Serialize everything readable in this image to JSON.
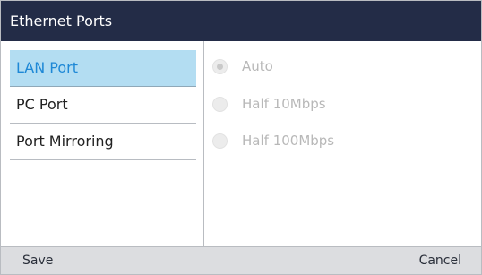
{
  "header": {
    "title": "Ethernet Ports"
  },
  "sidebar": {
    "items": [
      {
        "label": "LAN Port",
        "selected": true
      },
      {
        "label": "PC Port",
        "selected": false
      },
      {
        "label": "Port Mirroring",
        "selected": false
      }
    ]
  },
  "main": {
    "options": [
      {
        "label": "Auto",
        "checked": true,
        "disabled": true
      },
      {
        "label": "Half 10Mbps",
        "checked": false,
        "disabled": true
      },
      {
        "label": "Half 100Mbps",
        "checked": false,
        "disabled": true
      }
    ]
  },
  "softkeys": {
    "save_label": "Save",
    "cancel_label": "Cancel"
  },
  "colors": {
    "title_bar": "#232c47",
    "selected_bg": "#b3ddf2",
    "selected_text": "#1e88d6",
    "softkey_bar": "#dcdde0",
    "disabled_text": "#b8b8b8"
  }
}
